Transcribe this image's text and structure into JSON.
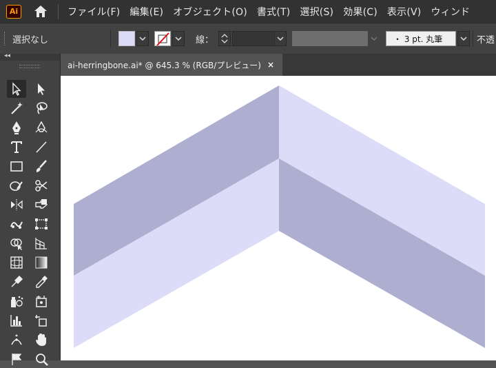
{
  "app": {
    "logo_text": "Ai"
  },
  "menu": {
    "items": [
      "ファイル(F)",
      "編集(E)",
      "オブジェクト(O)",
      "書式(T)",
      "選択(S)",
      "効果(C)",
      "表示(V)",
      "ウィンド"
    ]
  },
  "control_bar": {
    "selection_status": "選択なし",
    "stroke_label": "線：",
    "brush_value": "・  3 pt. 丸筆",
    "opacity_label": "不透"
  },
  "document": {
    "tab_title": "ai-herringbone.ai* @ 645.3 % (RGB/プレビュー)",
    "close_symbol": "×"
  },
  "toolbar": {
    "collapse_symbol": "◂◂",
    "active_tool": "selection-tool"
  },
  "colors": {
    "fill": "#dcdcf8",
    "shape_dark": "#aeaed0",
    "shape_light": "#dcdcf8",
    "accent_logo": "#ff9a00"
  }
}
